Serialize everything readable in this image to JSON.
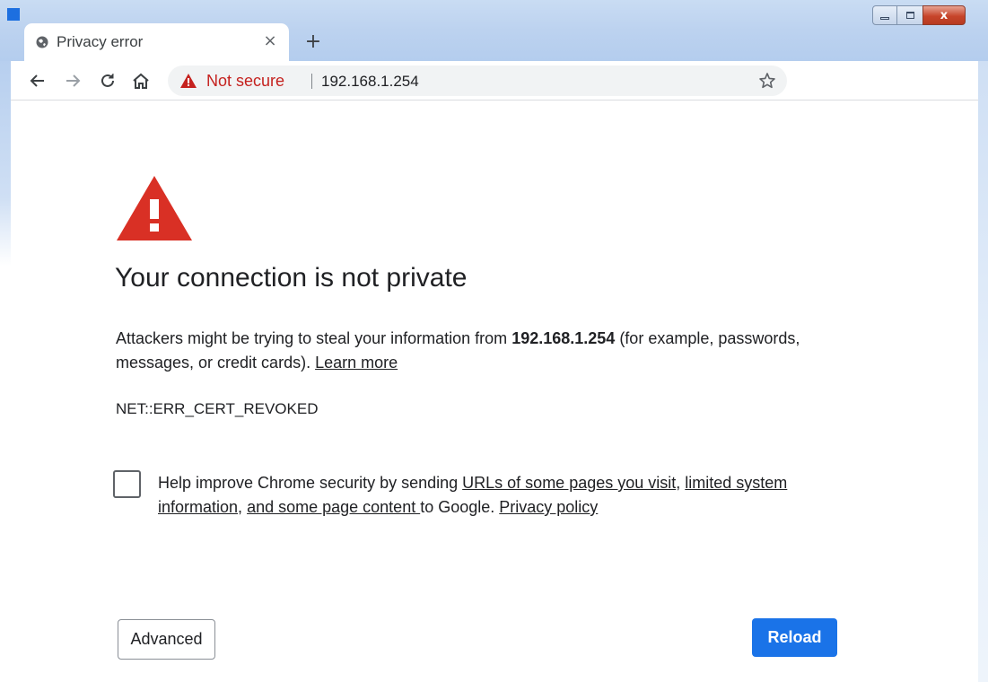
{
  "window": {
    "controls": {
      "minimize": "minimize",
      "maximize": "maximize",
      "close": "x"
    }
  },
  "tab": {
    "title": "Privacy error",
    "close_glyph": "×",
    "new_tab_glyph": "+"
  },
  "toolbar": {
    "security_label": "Not secure",
    "url": "192.168.1.254"
  },
  "content": {
    "heading": "Your connection is not private",
    "para_prefix": "Attackers might be trying to steal your information from ",
    "para_host": "192.168.1.254",
    "para_suffix": " (for example, passwords, messages, or credit cards). ",
    "learn_more": "Learn more",
    "error_code": "NET::ERR_CERT_REVOKED",
    "optin_prefix": "Help improve Chrome security by sending ",
    "optin_link1": "URLs of some pages you visit",
    "optin_comma": ", ",
    "optin_link2": "limited system information",
    "optin_comma2": ", ",
    "optin_link3": "and some page content ",
    "optin_mid": "to Google. ",
    "optin_link4": "Privacy policy",
    "checkbox_checked": false
  },
  "buttons": {
    "advanced": "Advanced",
    "reload": "Reload"
  },
  "icons": {
    "favicon": "globe-icon",
    "back": "back-arrow-icon",
    "forward": "forward-arrow-icon",
    "reload": "reload-icon",
    "home": "home-icon",
    "warning": "warning-triangle-icon",
    "star": "bookmark-star-icon"
  },
  "colors": {
    "warning_red": "#d93025",
    "not_secure_red": "#c5221f",
    "primary_blue": "#1a73e8",
    "frame_blue": "#bcd2ef"
  }
}
